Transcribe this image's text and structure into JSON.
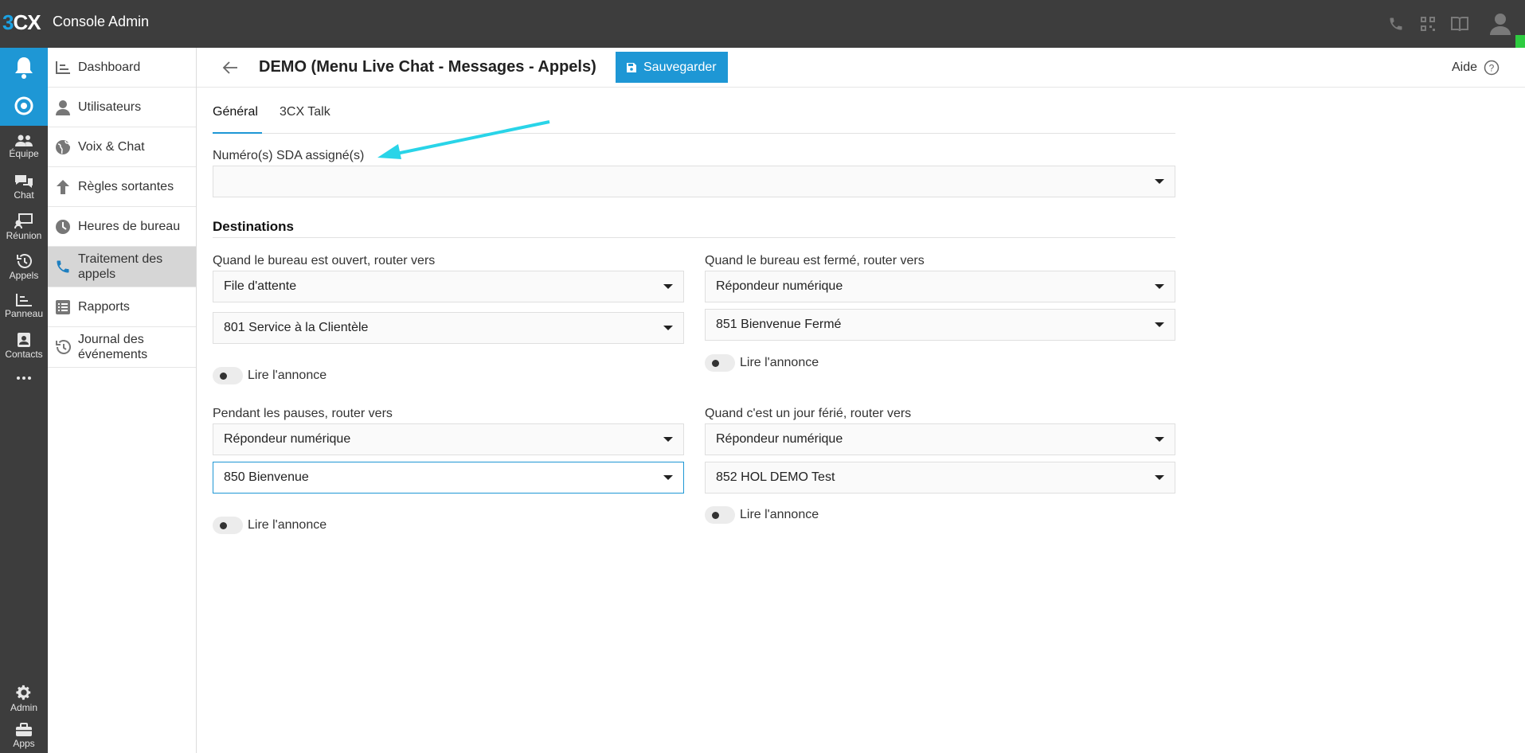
{
  "topbar": {
    "logo_prefix": "3",
    "logo_suffix": "CX",
    "title": "Console Admin"
  },
  "rail": {
    "items": [
      {
        "label": "Équipe"
      },
      {
        "label": "Chat"
      },
      {
        "label": "Réunion"
      },
      {
        "label": "Appels"
      },
      {
        "label": "Panneau"
      },
      {
        "label": "Contacts"
      },
      {
        "label": "Admin"
      },
      {
        "label": "Apps"
      }
    ]
  },
  "nav": {
    "items": [
      {
        "label": "Dashboard"
      },
      {
        "label": "Utilisateurs"
      },
      {
        "label": "Voix & Chat"
      },
      {
        "label": "Règles sortantes"
      },
      {
        "label": "Heures de bureau"
      },
      {
        "label": "Traitement des appels"
      },
      {
        "label": "Rapports"
      },
      {
        "label": "Journal des événements"
      }
    ]
  },
  "header": {
    "title": "DEMO (Menu Live Chat - Messages - Appels)",
    "save_label": "Sauvegarder",
    "help_label": "Aide"
  },
  "tabs": [
    {
      "label": "Général"
    },
    {
      "label": "3CX Talk"
    }
  ],
  "sda": {
    "label": "Numéro(s) SDA assigné(s)",
    "value": ""
  },
  "destinations": {
    "title": "Destinations",
    "open": {
      "label": "Quand le bureau est ouvert, router vers",
      "type": "File d'attente",
      "target": "801 Service à la Clientèle",
      "announce_label": "Lire l'annonce"
    },
    "closed": {
      "label": "Quand le bureau est fermé, router vers",
      "type": "Répondeur numérique",
      "target": "851 Bienvenue Fermé",
      "announce_label": "Lire l'annonce"
    },
    "breaks": {
      "label": "Pendant les pauses, router vers",
      "type": "Répondeur numérique",
      "target": "850 Bienvenue",
      "announce_label": "Lire l'annonce"
    },
    "holiday": {
      "label": "Quand c'est un jour férié, router vers",
      "type": "Répondeur numérique",
      "target": "852 HOL DEMO Test",
      "announce_label": "Lire l'annonce"
    }
  },
  "colors": {
    "accent": "#1e97d5",
    "topbar": "#3d3d3d",
    "annotation_arrow": "#29d4e8",
    "presence": "#2ecc40"
  }
}
